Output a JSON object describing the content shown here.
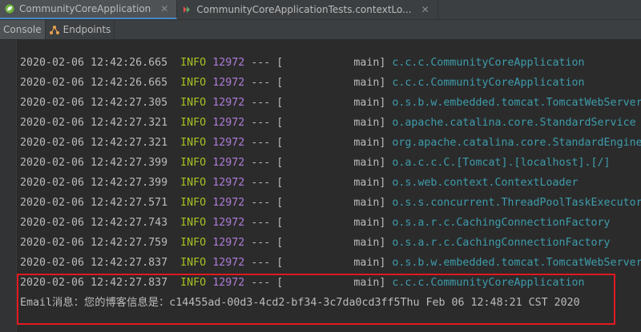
{
  "tabs": [
    {
      "label": "CommunityCoreApplication",
      "icon": "spring-leaf-icon",
      "active": true
    },
    {
      "label": "CommunityCoreApplicationTests.contextLo...",
      "icon": "run-test-icon",
      "active": false
    }
  ],
  "toolbar": {
    "console_label": "Console",
    "endpoints_label": "Endpoints"
  },
  "log_lines": [
    {
      "ts": "2020-02-06 12:42:26.665",
      "level": "INFO",
      "pid": "12972",
      "sep": "--- [",
      "thread": "main]",
      "cls": "c.c.c.CommunityCoreApplication"
    },
    {
      "ts": "2020-02-06 12:42:26.665",
      "level": "INFO",
      "pid": "12972",
      "sep": "--- [",
      "thread": "main]",
      "cls": "c.c.c.CommunityCoreApplication"
    },
    {
      "ts": "2020-02-06 12:42:27.305",
      "level": "INFO",
      "pid": "12972",
      "sep": "--- [",
      "thread": "main]",
      "cls": "o.s.b.w.embedded.tomcat.TomcatWebServer"
    },
    {
      "ts": "2020-02-06 12:42:27.321",
      "level": "INFO",
      "pid": "12972",
      "sep": "--- [",
      "thread": "main]",
      "cls": "o.apache.catalina.core.StandardService"
    },
    {
      "ts": "2020-02-06 12:42:27.321",
      "level": "INFO",
      "pid": "12972",
      "sep": "--- [",
      "thread": "main]",
      "cls": "org.apache.catalina.core.StandardEngine"
    },
    {
      "ts": "2020-02-06 12:42:27.399",
      "level": "INFO",
      "pid": "12972",
      "sep": "--- [",
      "thread": "main]",
      "cls": "o.a.c.c.C.[Tomcat].[localhost].[/]"
    },
    {
      "ts": "2020-02-06 12:42:27.399",
      "level": "INFO",
      "pid": "12972",
      "sep": "--- [",
      "thread": "main]",
      "cls": "o.s.web.context.ContextLoader"
    },
    {
      "ts": "2020-02-06 12:42:27.571",
      "level": "INFO",
      "pid": "12972",
      "sep": "--- [",
      "thread": "main]",
      "cls": "o.s.s.concurrent.ThreadPoolTaskExecutor"
    },
    {
      "ts": "2020-02-06 12:42:27.743",
      "level": "INFO",
      "pid": "12972",
      "sep": "--- [",
      "thread": "main]",
      "cls": "o.s.a.r.c.CachingConnectionFactory"
    },
    {
      "ts": "2020-02-06 12:42:27.759",
      "level": "INFO",
      "pid": "12972",
      "sep": "--- [",
      "thread": "main]",
      "cls": "o.s.a.r.c.CachingConnectionFactory"
    },
    {
      "ts": "2020-02-06 12:42:27.837",
      "level": "INFO",
      "pid": "12972",
      "sep": "--- [",
      "thread": "main]",
      "cls": "o.s.b.w.embedded.tomcat.TomcatWebServer"
    },
    {
      "ts": "2020-02-06 12:42:27.837",
      "level": "INFO",
      "pid": "12972",
      "sep": "--- [",
      "thread": "main]",
      "cls": "c.c.c.CommunityCoreApplication"
    }
  ],
  "email_line": "Email消息：您的博客信息是：c14455ad-00d3-4cd2-bf34-3c7da0cd3ff5Thu Feb 06 12:48:21 CST 2020",
  "colors": {
    "highlight_border": "#e0191f",
    "level": "#a8c023",
    "pid": "#b07cd8",
    "logger": "#3e9cac"
  }
}
